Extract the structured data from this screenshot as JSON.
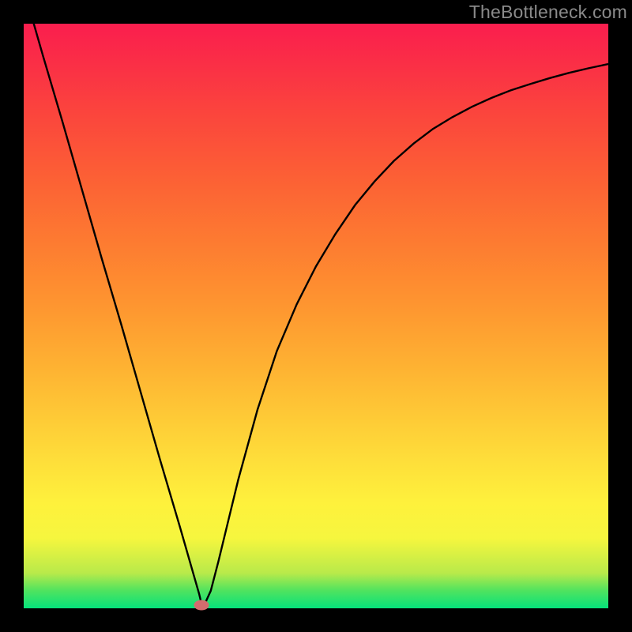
{
  "watermark": "TheBottleneck.com",
  "colors": {
    "curve_stroke": "#000000",
    "marker_fill": "#d46c6e",
    "frame_bg": "#000000"
  },
  "gradient_stops": [
    {
      "pos": 0.0,
      "color": "#05e27b"
    },
    {
      "pos": 0.03,
      "color": "#4fe35f"
    },
    {
      "pos": 0.06,
      "color": "#b8ea4a"
    },
    {
      "pos": 0.12,
      "color": "#f6f63e"
    },
    {
      "pos": 0.18,
      "color": "#fef13c"
    },
    {
      "pos": 0.25,
      "color": "#fedf3a"
    },
    {
      "pos": 0.33,
      "color": "#fec936"
    },
    {
      "pos": 0.42,
      "color": "#feb032"
    },
    {
      "pos": 0.52,
      "color": "#fe9530"
    },
    {
      "pos": 0.63,
      "color": "#fd7a31"
    },
    {
      "pos": 0.74,
      "color": "#fc5f35"
    },
    {
      "pos": 0.85,
      "color": "#fb443d"
    },
    {
      "pos": 0.95,
      "color": "#fa2a48"
    },
    {
      "pos": 1.0,
      "color": "#fa1e4e"
    }
  ],
  "chart_data": {
    "type": "line",
    "title": "",
    "xlabel": "",
    "ylabel": "",
    "xlim": [
      0,
      1
    ],
    "ylim": [
      0,
      1
    ],
    "x": [
      0.0,
      0.033,
      0.067,
      0.1,
      0.133,
      0.167,
      0.2,
      0.233,
      0.267,
      0.3,
      0.305,
      0.31,
      0.32,
      0.333,
      0.35,
      0.367,
      0.4,
      0.433,
      0.467,
      0.5,
      0.533,
      0.567,
      0.6,
      0.633,
      0.667,
      0.7,
      0.733,
      0.767,
      0.8,
      0.833,
      0.867,
      0.9,
      0.933,
      0.967,
      1.0
    ],
    "values": [
      1.06,
      0.945,
      0.83,
      0.715,
      0.6,
      0.485,
      0.37,
      0.255,
      0.14,
      0.025,
      0.004,
      0.008,
      0.03,
      0.08,
      0.15,
      0.22,
      0.34,
      0.44,
      0.52,
      0.585,
      0.64,
      0.69,
      0.73,
      0.765,
      0.795,
      0.82,
      0.84,
      0.858,
      0.873,
      0.886,
      0.897,
      0.907,
      0.916,
      0.924,
      0.931
    ],
    "marker": {
      "x": 0.304,
      "y": 0.005
    },
    "annotations": [],
    "legend": []
  }
}
